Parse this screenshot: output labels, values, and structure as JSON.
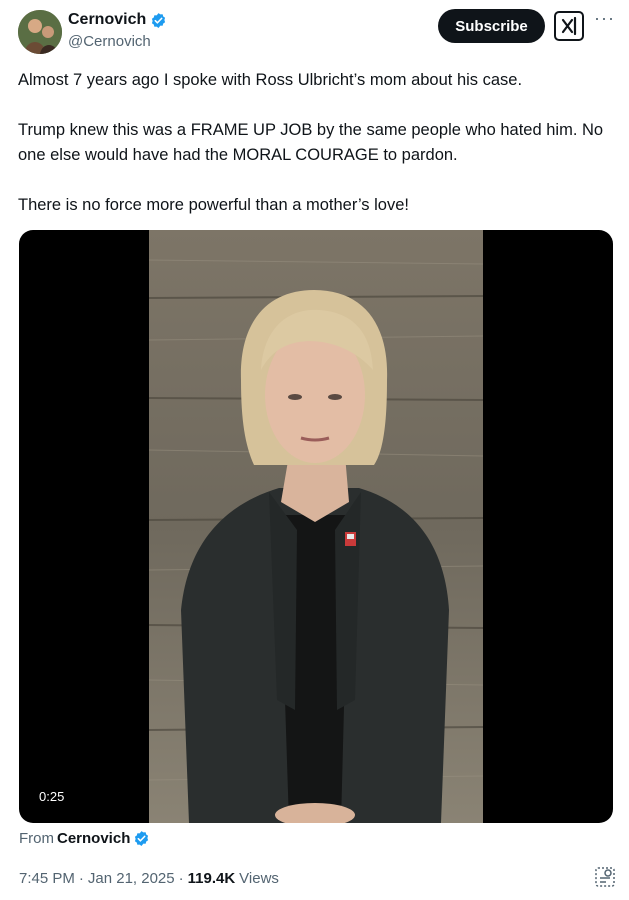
{
  "author": {
    "name": "Cernovich",
    "handle": "@Cernovich"
  },
  "actions": {
    "subscribe_label": "Subscribe",
    "grok_icon": "grok-icon",
    "more_label": "···"
  },
  "tweet": {
    "paragraphs": [
      "Almost 7 years ago I spoke with Ross Ulbricht’s mom about his case.",
      "Trump knew this was a FRAME UP JOB by the same people who hated him. No one else would have had the MORAL COURAGE to pardon.",
      "There is no force more powerful than a mother’s love!"
    ]
  },
  "video": {
    "duration": "0:25"
  },
  "source": {
    "prefix": "From",
    "author": "Cernovich"
  },
  "meta": {
    "time": "7:45 PM",
    "separator": "·",
    "date": "Jan 21, 2025",
    "views_count": "119.4K",
    "views_label": "Views"
  },
  "colors": {
    "text": "#0f1419",
    "secondary": "#536471",
    "verified": "#1d9bf0",
    "button": "#0f1419"
  }
}
